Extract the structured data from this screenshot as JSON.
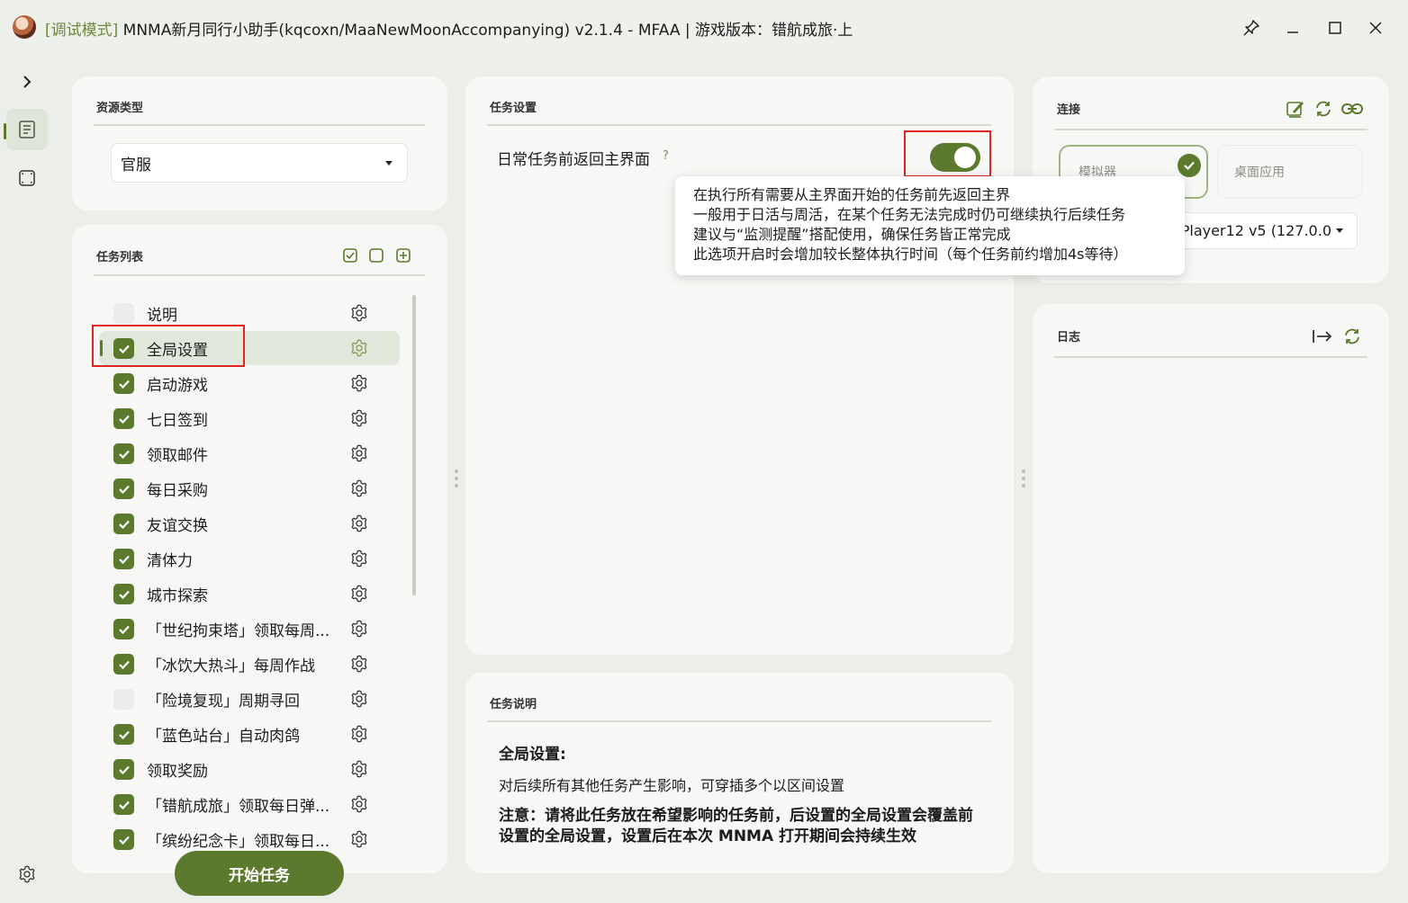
{
  "window": {
    "title_mode": "[调试模式]",
    "title_main": " MNMA新月同行小助手(kqcoxn/MaaNewMoonAccompanying) v2.1.4 - MFAA | 游戏版本：错航成旅·上"
  },
  "resource": {
    "title": "资源类型",
    "selected": "官服"
  },
  "task_list": {
    "title": "任务列表",
    "items": [
      {
        "label": "说明",
        "checked": false
      },
      {
        "label": "全局设置",
        "checked": true,
        "selected": true
      },
      {
        "label": "启动游戏",
        "checked": true
      },
      {
        "label": "七日签到",
        "checked": true
      },
      {
        "label": "领取邮件",
        "checked": true
      },
      {
        "label": "每日采购",
        "checked": true
      },
      {
        "label": "友谊交换",
        "checked": true
      },
      {
        "label": "清体力",
        "checked": true
      },
      {
        "label": "城市探索",
        "checked": true
      },
      {
        "label": "「世纪拘束塔」领取每周...",
        "checked": true
      },
      {
        "label": "「冰饮大热斗」每周作战",
        "checked": true
      },
      {
        "label": "「险境复现」周期寻回",
        "checked": false
      },
      {
        "label": "「蓝色站台」自动肉鸽",
        "checked": true
      },
      {
        "label": "领取奖励",
        "checked": true
      },
      {
        "label": "「错航成旅」领取每日弹...",
        "checked": true
      },
      {
        "label": "「缤纷纪念卡」领取每日...",
        "checked": true
      }
    ],
    "start_button": "开始任务"
  },
  "task_settings": {
    "title": "任务设置",
    "option_label": "日常任务前返回主界面",
    "help": "?",
    "toggle_on": true,
    "tooltip": [
      "在执行所有需要从主界面开始的任务前先返回主界",
      "一般用于日活与周活，在某个任务无法完成时仍可继续执行后续任务",
      "建议与“监测提醒”搭配使用，确保任务皆正常完成",
      "此选项开启时会增加较长整体执行时间（每个任务前约增加4s等待）"
    ]
  },
  "task_description": {
    "title": "任务说明",
    "heading": "全局设置:",
    "text": "对后续所有其他任务产生影响，可穿插多个以区间设置",
    "note": "注意：请将此任务放在希望影响的任务前，后设置的全局设置会覆盖前设置的全局设置，设置后在本次 MNMA 打开期间会持续生效"
  },
  "connection": {
    "title": "连接",
    "option_emulator": "模拟器",
    "option_desktop": "桌面应用",
    "device": "uPlayer12 v5 (127.0.0"
  },
  "log": {
    "title": "日志"
  },
  "colors": {
    "accent": "#5b7a2e",
    "highlight": "#e0261f"
  }
}
